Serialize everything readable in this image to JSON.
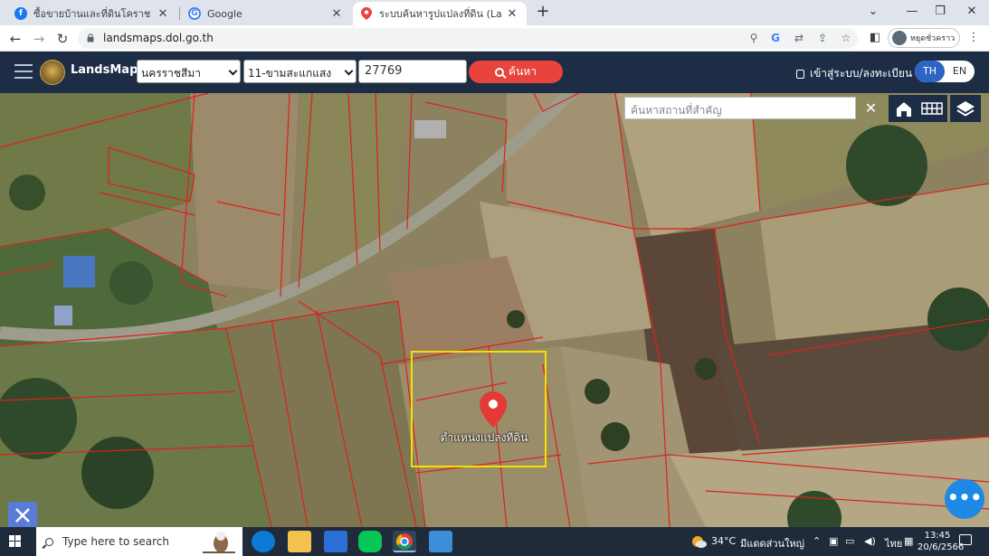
{
  "browser": {
    "tabs": [
      {
        "title": "ซื้อขายบ้านและที่ดินโคราช | Facebook",
        "favicon": "facebook-icon"
      },
      {
        "title": "Google",
        "favicon": "google-icon"
      },
      {
        "title": "ระบบค้นหารูปแปลงที่ดิน (LandsMaps",
        "favicon": "map-pin-icon"
      }
    ],
    "url": "landsmaps.dol.go.th",
    "profile_label": "หยุดชั่วคราว"
  },
  "app": {
    "brand": "LandsMaps",
    "province": "นครราชสีมา",
    "district": "11-ขามสะแกแสง",
    "parcel_number": "27769",
    "search_label": "ค้นหา",
    "login_label": "เข้าสู่ระบบ/ลงทะเบียน",
    "lang_th": "TH",
    "lang_en": "EN"
  },
  "map": {
    "place_search_placeholder": "ค้นหาสถานที่สำคัญ",
    "marker_label": "ตำแหน่งแปลงที่ดิน",
    "fab_label": "•••",
    "colors": {
      "parcel_line": "#e0201c",
      "highlight": "#f5e000",
      "marker": "#e53935"
    }
  },
  "taskbar": {
    "search_placeholder": "Type here to search",
    "weather": "34°C",
    "weather_text": "มีแดดส่วนใหญ่",
    "lang": "ไทย",
    "time": "13:45",
    "date": "20/6/2566"
  }
}
